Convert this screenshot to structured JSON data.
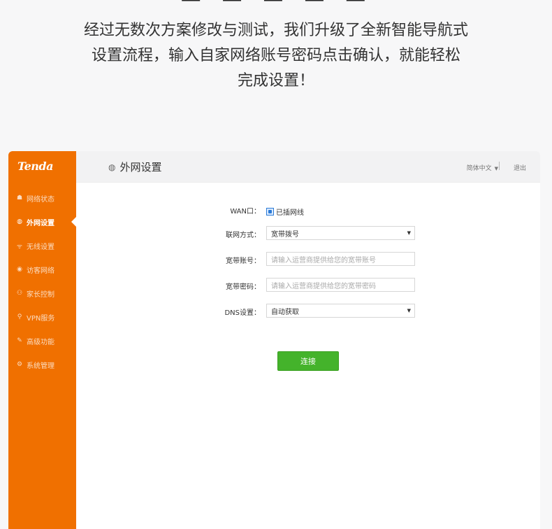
{
  "promo": {
    "lines": [
      "经过无数次方案修改与测试，我们升级了全新智能导航式",
      "设置流程，输入自家网络账号密码点击确认，就能轻松",
      "完成设置！"
    ]
  },
  "app": {
    "logo": "Tenda",
    "sidebar": {
      "items": [
        {
          "label": "网络状态",
          "icon": "user-icon",
          "glyph": "☗"
        },
        {
          "label": "外网设置",
          "icon": "globe-icon",
          "glyph": "◍",
          "active": true
        },
        {
          "label": "无线设置",
          "icon": "wifi-icon",
          "glyph": "ᯤ"
        },
        {
          "label": "访客网络",
          "icon": "guest-icon",
          "glyph": "◉"
        },
        {
          "label": "家长控制",
          "icon": "parent-icon",
          "glyph": "⚇"
        },
        {
          "label": "VPN服务",
          "icon": "vpn-icon",
          "glyph": "⚲"
        },
        {
          "label": "高级功能",
          "icon": "tools-icon",
          "glyph": "✎"
        },
        {
          "label": "系统管理",
          "icon": "gear-icon",
          "glyph": "⚙"
        }
      ]
    },
    "header": {
      "title": "外网设置",
      "language": "简体中文",
      "logout": "退出"
    },
    "form": {
      "wan_label": "WAN口：",
      "wan_status": "已插网线",
      "mode_label": "联网方式：",
      "mode_value": "宽带拨号",
      "account_label": "宽带账号：",
      "account_placeholder": "请输入运营商提供给您的宽带账号",
      "password_label": "宽带密码：",
      "password_placeholder": "请输入运营商提供给您的宽带密码",
      "dns_label": "DNS设置：",
      "dns_value": "自动获取",
      "connect_button": "连接"
    },
    "colors": {
      "sidebar": "#f07000",
      "button": "#44b32b",
      "accent": "#2a7ad6"
    }
  }
}
